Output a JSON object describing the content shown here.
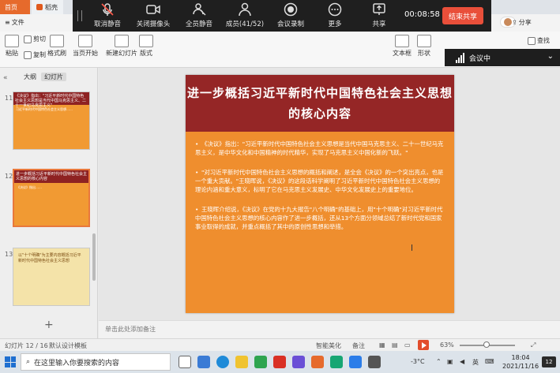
{
  "window": {
    "home_tab": "首页",
    "doc_tab": "稻壳"
  },
  "meeting": {
    "buttons": [
      {
        "label": "取消静音",
        "icon": "mic-muted-icon"
      },
      {
        "label": "关闭摄像头",
        "icon": "camera-icon"
      },
      {
        "label": "全员静音",
        "icon": "all-mute-icon"
      },
      {
        "label": "成员(41/52)",
        "icon": "members-icon"
      },
      {
        "label": "会议录制",
        "icon": "record-icon"
      },
      {
        "label": "更多",
        "icon": "more-icon"
      },
      {
        "label": "共享",
        "icon": "share-screen-icon"
      }
    ],
    "timer": "00:08:58",
    "end_share": "结束共享",
    "panel_status": "会议中"
  },
  "ribbon": {
    "row1": [
      {
        "label": "文件",
        "icon": "menu-icon"
      },
      {
        "label": "分享",
        "icon": "share-icon"
      }
    ],
    "row2": [
      {
        "label": "剪切",
        "icon": "cut-icon"
      },
      {
        "label": "粘贴",
        "icon": "paste-icon"
      },
      {
        "label": "复制",
        "icon": "copy-icon"
      },
      {
        "label": "格式刷",
        "icon": "format-painter-icon"
      },
      {
        "label": "当页开始",
        "icon": "play-from-current-icon"
      },
      {
        "label": "新建幻灯片",
        "icon": "new-slide-icon"
      },
      {
        "label": "版式",
        "icon": "layout-icon"
      },
      {
        "label": "文本框",
        "icon": "textbox-icon"
      },
      {
        "label": "形状",
        "icon": "shape-icon"
      },
      {
        "label": "查找",
        "icon": "find-icon"
      }
    ]
  },
  "outline": {
    "tabs": [
      "大纲",
      "幻灯片"
    ],
    "slides": [
      {
        "num": "11",
        "head": "《决议》指出：\"习近平新时代中国特色社会主义思想是当代中国马克思主义、二十一世纪马克思主义\"",
        "body": "习近平新时代中国特色社会主义思想……",
        "style": "red"
      },
      {
        "num": "12",
        "head": "进一步概括习近平新时代中国特色社会主义思想的核心内容",
        "body": "《决议》指出……",
        "style": "red"
      },
      {
        "num": "13",
        "head": "以\"十个明确\"为主要内容概括习近平新时代中国特色社会主义思想",
        "body": "",
        "style": "gold"
      }
    ],
    "add_label": "+"
  },
  "slide": {
    "title": "进一步概括习近平新时代中国特色社会主义思想的核心内容",
    "paragraphs": [
      "《决议》指出：\"习近平新时代中国特色社会主义思想是当代中国马克思主义、二十一世纪马克思主义，是中华文化和中国精神的时代精华，实现了马克思主义中国化新的飞跃。\"",
      "\"对习近平新时代中国特色社会主义思想的概括和阐述，是全会《决议》的一个突出亮点，也是一个重大贡献。\"王晓晖说，《决议》的这段话科学阐明了习近平新时代中国特色社会主义思想的理论内涵和重大意义，标明了它在马克思主义发展史、中华文化发展史上的重要地位。",
      "王晓晖介绍说，《决议》在党的十九大报告\"八个明确\"的基础上，用\"十个明确\"对习近平新时代中国特色社会主义思想的核心内容作了进一步概括，还从13个方面分领域总结了新时代党和国家事业取得的成就，并重点概括了其中的原创性思想和举措。"
    ],
    "notes_placeholder": "单击此处添加备注"
  },
  "status": {
    "slide_counter": "幻灯片 12 / 16",
    "theme": "默认设计模板",
    "beautify": "智能美化",
    "notes": "备注",
    "zoom": "63%"
  },
  "taskbar": {
    "search_placeholder": "在这里输入你要搜索的内容",
    "weather": "-3°C",
    "ime": "英",
    "time": "18:04",
    "date": "2021/11/16",
    "badge": "12"
  },
  "colors": {
    "title_bg": "#952626",
    "body_bg": "#ef8e2e",
    "accent": "#e66a2c",
    "end_share": "#e94f3a"
  }
}
